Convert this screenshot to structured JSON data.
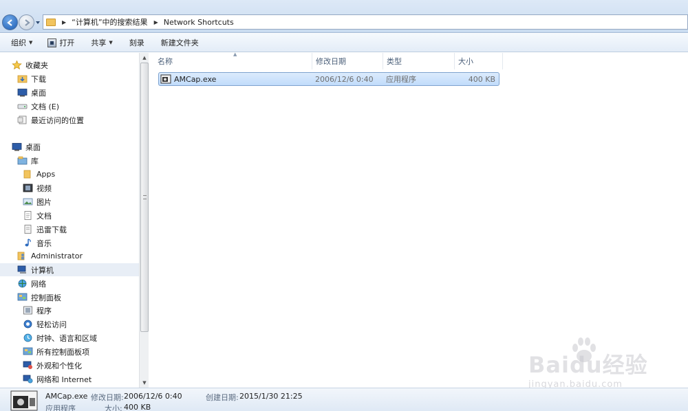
{
  "address_bar": {
    "breadcrumbs": [
      "“计算机”中的搜索结果",
      "Network Shortcuts"
    ]
  },
  "toolbar": {
    "organize": "组织",
    "open": "打开",
    "share": "共享",
    "burn": "刻录",
    "new_folder": "新建文件夹"
  },
  "nav_pane": {
    "items": [
      {
        "label": "收藏夹",
        "icon": "star-icon"
      },
      {
        "label": "下载",
        "icon": "downloads-folder-icon"
      },
      {
        "label": "桌面",
        "icon": "desktop-icon"
      },
      {
        "label": "文档 (E)",
        "icon": "drive-icon"
      },
      {
        "label": "最近访问的位置",
        "icon": "recent-places-icon"
      },
      {
        "label": "桌面",
        "icon": "desktop-icon"
      },
      {
        "label": "库",
        "icon": "library-icon"
      },
      {
        "label": "Apps",
        "icon": "folder-icon"
      },
      {
        "label": "视频",
        "icon": "video-icon"
      },
      {
        "label": "图片",
        "icon": "pictures-icon"
      },
      {
        "label": "文档",
        "icon": "documents-icon"
      },
      {
        "label": "迅雷下载",
        "icon": "download-icon"
      },
      {
        "label": "音乐",
        "icon": "music-icon"
      },
      {
        "label": "Administrator",
        "icon": "user-folder-icon"
      },
      {
        "label": "计算机",
        "icon": "computer-icon"
      },
      {
        "label": "网络",
        "icon": "network-icon"
      },
      {
        "label": "控制面板",
        "icon": "control-panel-icon"
      },
      {
        "label": "程序",
        "icon": "programs-icon"
      },
      {
        "label": "轻松访问",
        "icon": "ease-of-access-icon"
      },
      {
        "label": "时钟、语言和区域",
        "icon": "clock-language-icon"
      },
      {
        "label": "所有控制面板项",
        "icon": "all-control-panel-icon"
      },
      {
        "label": "外观和个性化",
        "icon": "appearance-icon"
      },
      {
        "label": "网络和 Internet",
        "icon": "network-internet-icon"
      }
    ]
  },
  "columns": {
    "name": "名称",
    "date": "修改日期",
    "type": "类型",
    "size": "大小"
  },
  "files": [
    {
      "name": "AMCap.exe",
      "date": "2006/12/6 0:40",
      "type": "应用程序",
      "size": "400 KB"
    }
  ],
  "details": {
    "name": "AMCap.exe",
    "modified_label": "修改日期:",
    "modified_value": "2006/12/6 0:40",
    "created_label": "创建日期:",
    "created_value": "2015/1/30 21:25",
    "type": "应用程序",
    "size_label": "大小:",
    "size_value": "400 KB"
  },
  "watermark": {
    "main": "Baidu经验",
    "sub": "jingyan.baidu.com"
  },
  "colors": {
    "selection": "#c1dcfb",
    "selection_border": "#7da2ce",
    "header_text": "#4c607a"
  }
}
